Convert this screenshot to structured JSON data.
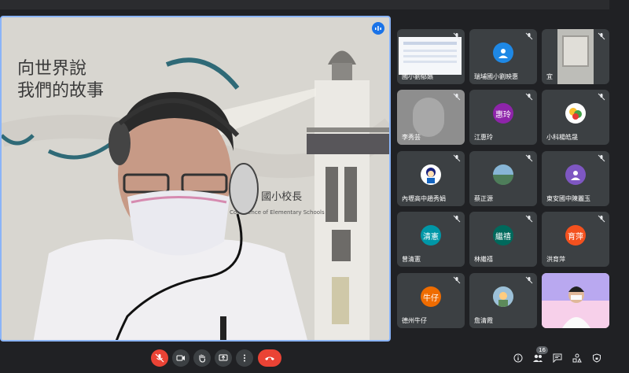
{
  "participants": [
    {
      "name": "國小劉郁嬿",
      "avatar_type": "screen",
      "muted": true
    },
    {
      "name": "瑞埔國小劉映惠",
      "avatar_type": "icon",
      "avatar_color": "#1e88e5",
      "muted": true
    },
    {
      "name": "宜",
      "avatar_type": "photo",
      "muted": true
    },
    {
      "name": "李秀芸",
      "avatar_type": "video",
      "muted": true
    },
    {
      "name": "江惠玲",
      "avatar_type": "initials",
      "initials": "惠玲",
      "avatar_color": "#8e24aa",
      "muted": true
    },
    {
      "name": "小科楊皓晟",
      "avatar_type": "image",
      "muted": true
    },
    {
      "name": "內壢高中趙秀娟",
      "avatar_type": "image",
      "muted": true
    },
    {
      "name": "蔡正源",
      "avatar_type": "image",
      "muted": true
    },
    {
      "name": "東安國中陳麗玉",
      "avatar_type": "icon",
      "avatar_color": "#7e57c2",
      "muted": true
    },
    {
      "name": "曾清憲",
      "avatar_type": "initials",
      "initials": "清憲",
      "avatar_color": "#0097a7",
      "muted": true
    },
    {
      "name": "林繼禧",
      "avatar_type": "initials",
      "initials": "繼禧",
      "avatar_color": "#00695c",
      "muted": true
    },
    {
      "name": "洪育萍",
      "avatar_type": "initials",
      "initials": "育萍",
      "avatar_color": "#f4511e",
      "muted": true
    },
    {
      "name": "德州牛仔",
      "avatar_type": "initials",
      "initials": "牛仔",
      "avatar_color": "#ef6c00",
      "muted": true
    },
    {
      "name": "詹清霞",
      "avatar_type": "image",
      "muted": true
    },
    {
      "name": "",
      "avatar_type": "video",
      "muted": false
    }
  ],
  "main_speaker": {
    "banner_lines": [
      "向世界說",
      "我們的故事"
    ],
    "banner_sub": "年度 國小校長",
    "banner_en": "Conference of Elementary Schools",
    "speaking": true
  },
  "controls": {
    "mic_icon": "mic-off-icon",
    "camera_icon": "camera-icon",
    "hand_icon": "raise-hand-icon",
    "present_icon": "present-icon",
    "more_icon": "more-vert-icon",
    "hangup_icon": "call-end-icon"
  },
  "right_controls": {
    "people_count": "16"
  },
  "colors": {
    "accent": "#8ab4f8",
    "danger": "#ea4335",
    "tile_bg": "#3c4043",
    "page_bg": "#202124"
  }
}
